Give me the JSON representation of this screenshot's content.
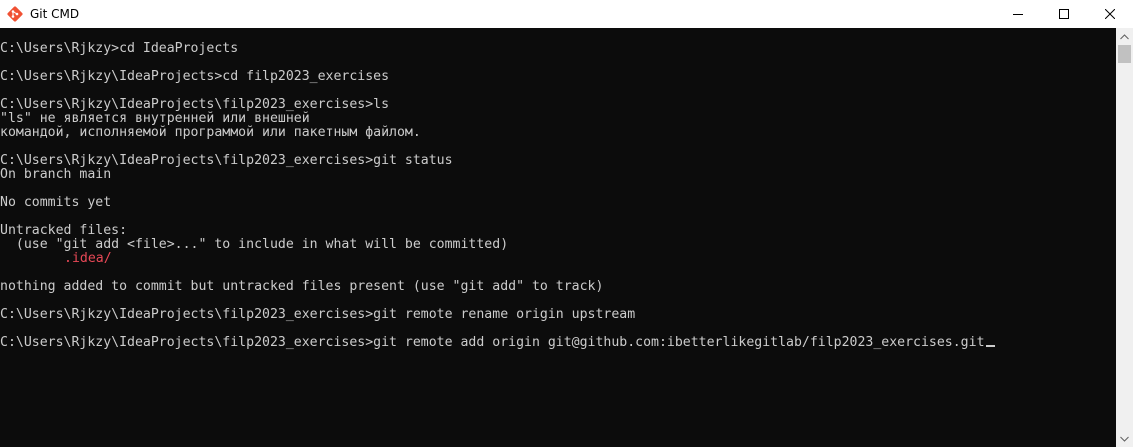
{
  "window": {
    "title": "Git CMD",
    "controls": {
      "minimize": "minimize-icon",
      "maximize": "maximize-icon",
      "close": "close-icon"
    }
  },
  "terminal": {
    "lines": [
      {
        "text": "C:\\Users\\Rjkzy>cd IdeaProjects"
      },
      {
        "text": "C:\\Users\\Rjkzy\\IdeaProjects>cd filp2023_exercises"
      },
      {
        "text": "C:\\Users\\Rjkzy\\IdeaProjects\\filp2023_exercises>ls"
      },
      {
        "text": "\"ls\" не является внутренней или внешней"
      },
      {
        "text": "командой, исполняемой программой или пакетным файлом."
      },
      {
        "text": "C:\\Users\\Rjkzy\\IdeaProjects\\filp2023_exercises>git status"
      },
      {
        "text": "On branch main"
      },
      {
        "text": "No commits yet"
      },
      {
        "text": "Untracked files:"
      },
      {
        "text": "  (use \"git add <file>...\" to include in what will be committed)"
      },
      {
        "text": ".idea/",
        "color": "#e74856"
      },
      {
        "text": "nothing added to commit but untracked files present (use \"git add\" to track)"
      },
      {
        "text": "C:\\Users\\Rjkzy\\IdeaProjects\\filp2023_exercises>git remote rename origin upstream"
      },
      {
        "text": "C:\\Users\\Rjkzy\\IdeaProjects\\filp2023_exercises>git remote add origin git@github.com:ibetterlikegitlab/filp2023_exercises.git"
      }
    ]
  },
  "colors": {
    "background": "#0c0c0c",
    "foreground": "#cccccc",
    "untracked": "#e74856"
  }
}
